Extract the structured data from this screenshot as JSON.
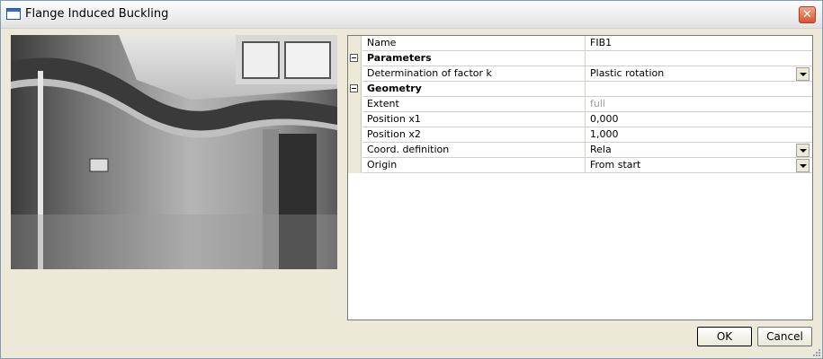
{
  "window": {
    "title": "Flange Induced Buckling"
  },
  "properties": {
    "rows": [
      {
        "name": "Name",
        "value": "FIB1",
        "type": "text"
      },
      {
        "name": "Parameters",
        "value": "",
        "type": "section"
      },
      {
        "name": "Determination of factor k",
        "value": "Plastic rotation",
        "type": "dropdown"
      },
      {
        "name": "Geometry",
        "value": "",
        "type": "section"
      },
      {
        "name": "Extent",
        "value": "full",
        "type": "disabled"
      },
      {
        "name": "Position x1",
        "value": "0,000",
        "type": "text"
      },
      {
        "name": "Position x2",
        "value": "1,000",
        "type": "text"
      },
      {
        "name": "Coord. definition",
        "value": "Rela",
        "type": "dropdown"
      },
      {
        "name": "Origin",
        "value": "From start",
        "type": "dropdown"
      }
    ]
  },
  "buttons": {
    "ok": "OK",
    "cancel": "Cancel"
  },
  "icons": {
    "window": "window-icon",
    "close": "close-icon",
    "collapse": "collapse-icon",
    "dropdown": "dropdown-arrow-icon"
  }
}
